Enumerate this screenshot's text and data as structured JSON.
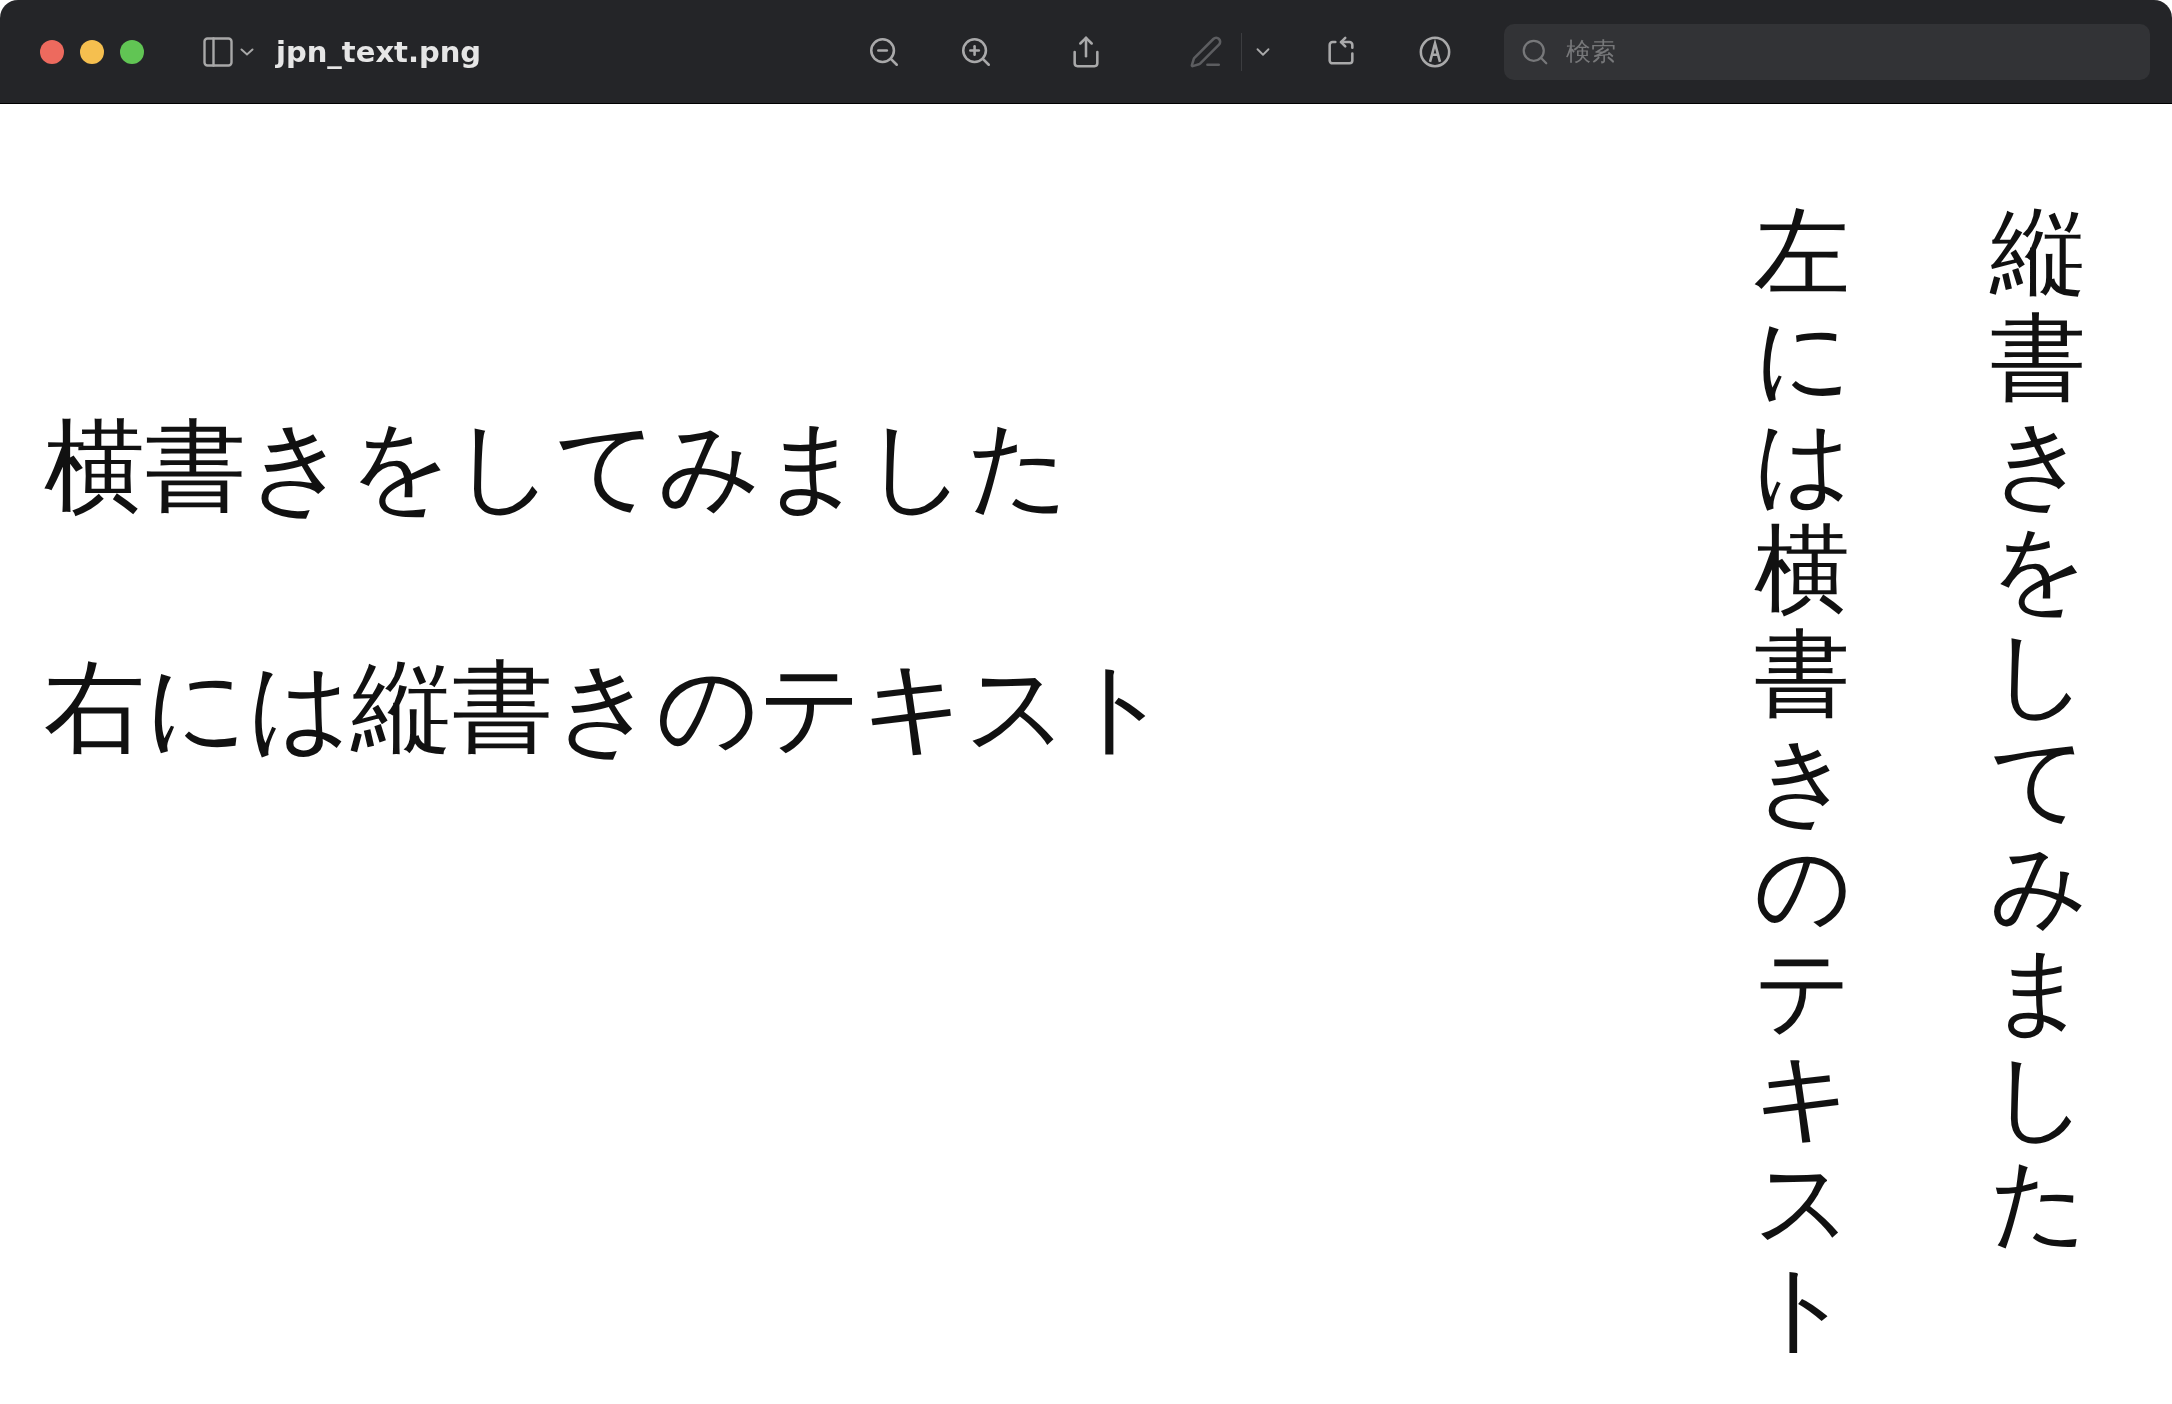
{
  "window": {
    "title": "jpn_text.png"
  },
  "toolbar": {
    "tools": [
      {
        "kind": "zoom-out",
        "disabled": false
      },
      {
        "kind": "zoom-in",
        "disabled": false
      },
      {
        "kind": "share",
        "disabled": false
      },
      {
        "kind": "highlight",
        "disabled": true
      },
      {
        "kind": "highlight-menu",
        "disabled": false
      },
      {
        "kind": "rotate",
        "disabled": false
      },
      {
        "kind": "markup",
        "disabled": false
      }
    ],
    "search": {
      "placeholder": "検索"
    }
  },
  "document": {
    "horizontal_lines": [
      "横書きをしてみました",
      "右には縦書きのテキスト"
    ],
    "vertical_columns": [
      "左には横書きのテキスト",
      "縦書きをしてみました"
    ]
  }
}
